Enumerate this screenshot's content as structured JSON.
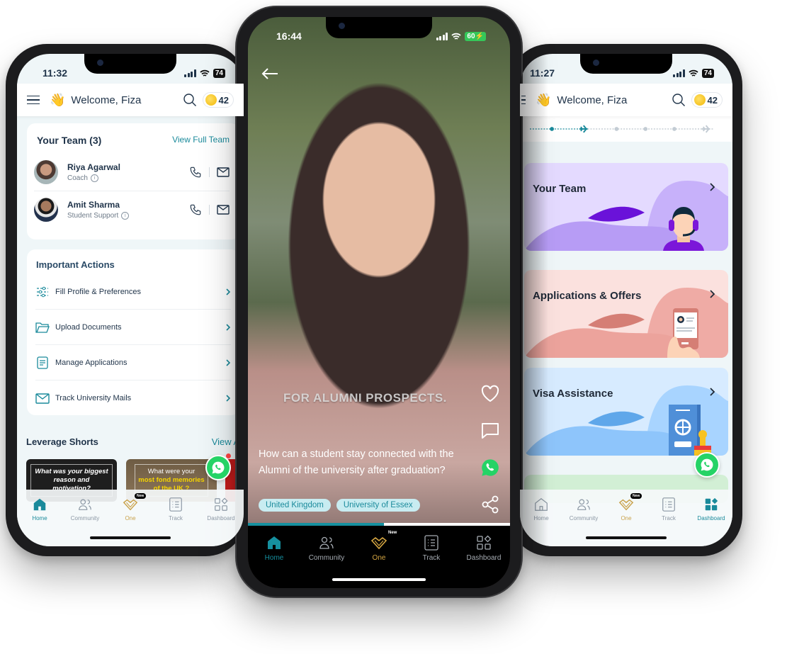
{
  "phones": {
    "left": {
      "status": {
        "time": "11:32",
        "battery": "74"
      },
      "header": {
        "greeting_emoji": "👋",
        "welcome": "Welcome, Fiza",
        "coins": "42"
      },
      "team": {
        "title": "Your Team (3)",
        "view_link": "View Full Team",
        "members": [
          {
            "name": "Riya Agarwal",
            "role": "Coach"
          },
          {
            "name": "Amit Sharma",
            "role": "Student Support"
          }
        ]
      },
      "actions": {
        "title": "Important Actions",
        "items": [
          {
            "label": "Fill Profile & Preferences",
            "icon": "sliders-icon"
          },
          {
            "label": "Upload Documents",
            "icon": "folder-icon"
          },
          {
            "label": "Manage Applications",
            "icon": "document-icon"
          },
          {
            "label": "Track University Mails",
            "icon": "mail-icon"
          }
        ]
      },
      "shorts": {
        "title": "Leverage Shorts",
        "view_all": "View All",
        "items": [
          {
            "text": "What was your biggest reason and motivation?"
          },
          {
            "text_a": "What were your",
            "text_b": "most fond memories",
            "text_c": "of the UK ?"
          }
        ]
      },
      "active_tab": "Home"
    },
    "center": {
      "status": {
        "time": "16:44",
        "battery": "60"
      },
      "overlay_caption": "FOR ALUMNI PROSPECTS.",
      "question": "How can a student stay connected with the Alumni of the university after graduation?",
      "tags": [
        "United Kingdom",
        "University of Essex"
      ],
      "progress_percent": 52,
      "active_tab": "Home"
    },
    "right": {
      "status": {
        "time": "11:27",
        "battery": "74"
      },
      "header": {
        "greeting_emoji": "👋",
        "welcome": "Welcome, Fiza",
        "coins": "42"
      },
      "features": [
        {
          "title": "Your Team"
        },
        {
          "title": "Applications & Offers"
        },
        {
          "title": "Visa Assistance"
        }
      ],
      "active_tab": "Dashboard"
    }
  },
  "tabs": [
    {
      "label": "Home",
      "icon": "home-icon"
    },
    {
      "label": "Community",
      "icon": "community-icon"
    },
    {
      "label": "One",
      "icon": "diamond-icon",
      "badge": "New"
    },
    {
      "label": "Track",
      "icon": "checklist-icon"
    },
    {
      "label": "Dashboard",
      "icon": "grid-icon"
    }
  ],
  "colors": {
    "accent": "#1a8a9b",
    "gold": "#c9a24c",
    "navy": "#1f3349",
    "whatsapp": "#25d366"
  }
}
